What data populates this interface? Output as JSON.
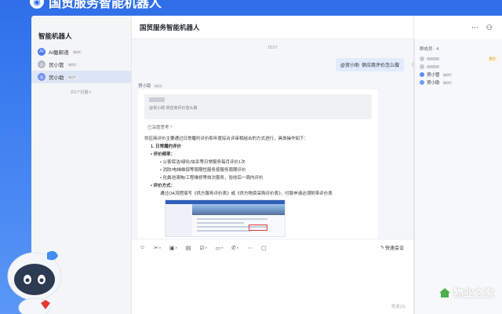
{
  "app": {
    "title": "国贸服务智能机器人"
  },
  "sidebar": {
    "title": "智能机器人",
    "items": [
      {
        "label": "AI搬邮递",
        "tag": "BOT",
        "icon_color": "#4a7cf0"
      },
      {
        "label": "贸小管",
        "tag": "BOT",
        "icon_color": "#b0b7c3"
      },
      {
        "label": "贸小助",
        "tag": "BOT",
        "icon_color": "#6e8ff0",
        "active": true
      }
    ],
    "count": "共3个机器人"
  },
  "chat": {
    "title": "国贸服务智能机器人",
    "timestamp": "18:57",
    "my_message": {
      "mention": "@贸小助",
      "text": "供应商评价怎么做"
    },
    "reply": {
      "sender": "贸小助",
      "sender_tag": "BOT",
      "quote": "@贸小助 供应商评价怎么做",
      "thinking": "已深度思考 ^",
      "intro": "供应商评价主要通过日常履约评价和年度综合评审相结合的方式进行，具体操作如下：",
      "section1": "1. 日常履约评价",
      "freq_title": "评价频率：",
      "freq_items": [
        "公客保洁/绿化/虫杀等日常服务每月评价1次",
        "消防/电梯维保等周期性服务按服务周期评价",
        "化粪池清掏/工程维修等效次服务，验收后一周内评价"
      ],
      "method_title": "评价方式：",
      "method_text": "通过OA流程填写《供方服务评价表》或《供方物资采购评价表》，付款申请必须附带评价表"
    },
    "toolbar": {
      "tools": [
        "smile-icon",
        "scissors-icon",
        "image-icon",
        "doc-icon",
        "check-icon",
        "folder-icon",
        "phone-icon",
        "more-icon",
        "video-icon"
      ],
      "quick_meeting": "快速会议"
    },
    "send_label": "发送(S)"
  },
  "members": {
    "title": "群成员 · 4",
    "list": [
      {
        "name": "",
        "tag": "群主",
        "color": "#c3cad6",
        "blurred": true
      },
      {
        "name": "",
        "tag": "",
        "color": "#c3cad6",
        "blurred": true
      },
      {
        "name": "贸小管",
        "tag": "BOT",
        "color": "#5b8ff2"
      },
      {
        "name": "贸小助",
        "tag": "BOT",
        "color": "#6aa0f5"
      }
    ]
  },
  "watermark": {
    "text": "物业之家"
  }
}
